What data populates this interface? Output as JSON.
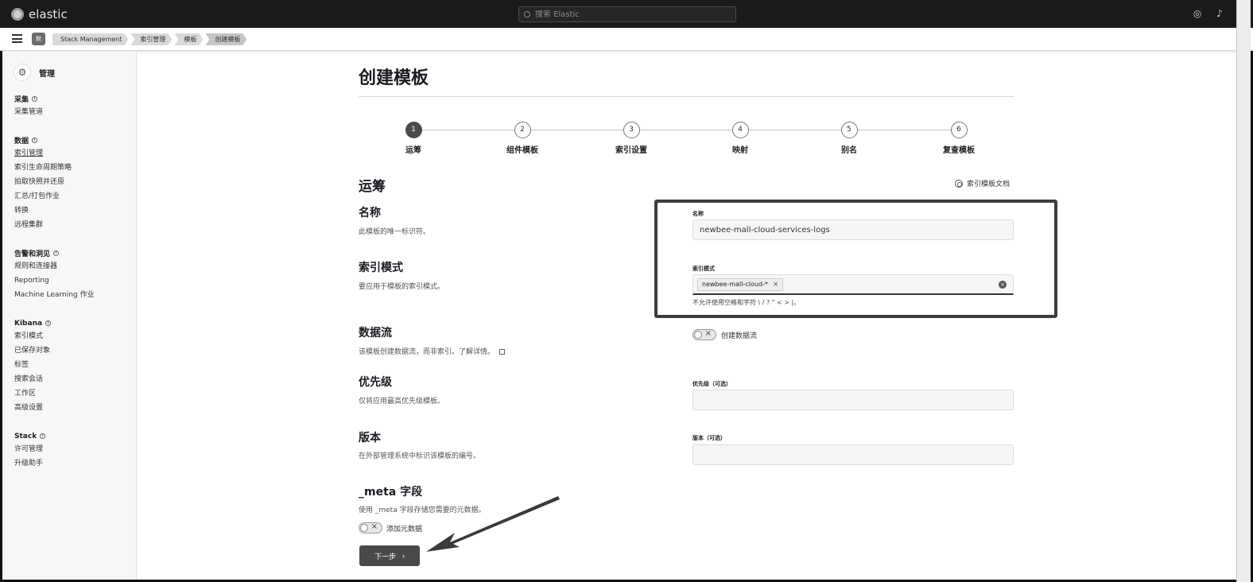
{
  "topbar": {
    "brand": "elastic",
    "search_placeholder": "搜索 Elastic"
  },
  "breadcrumb": {
    "space_initial": "默",
    "items": [
      "Stack Management",
      "索引管理",
      "模板",
      "创建模板"
    ]
  },
  "sidebar": {
    "title": "管理",
    "groups": [
      {
        "title": "采集",
        "items": [
          "采集管道"
        ]
      },
      {
        "title": "数据",
        "items": [
          "索引管理",
          "索引生命周期策略",
          "拍取快照并还原",
          "汇总/打包作业",
          "转换",
          "远程集群"
        ]
      },
      {
        "title": "告警和洞见",
        "items": [
          "规则和连接器",
          "Reporting",
          "Machine Learning 作业"
        ]
      },
      {
        "title": "Kibana",
        "items": [
          "索引模式",
          "已保存对象",
          "标签",
          "搜索会话",
          "工作区",
          "高级设置"
        ]
      },
      {
        "title": "Stack",
        "items": [
          "许可管理",
          "升级助手"
        ]
      }
    ]
  },
  "page": {
    "title": "创建模板",
    "steps": [
      {
        "num": "1",
        "label": "运筹"
      },
      {
        "num": "2",
        "label": "组件模板"
      },
      {
        "num": "3",
        "label": "索引设置"
      },
      {
        "num": "4",
        "label": "映射"
      },
      {
        "num": "5",
        "label": "别名"
      },
      {
        "num": "6",
        "label": "复查模板"
      }
    ],
    "current_step": 1,
    "section_title": "运筹",
    "doc_link": "索引模板文档",
    "fields": {
      "name": {
        "title": "名称",
        "desc": "此模板的唯一标识符。",
        "label": "名称",
        "value": "newbee-mall-cloud-services-logs"
      },
      "index_pattern": {
        "title": "索引模式",
        "desc": "要应用于模板的索引模式。",
        "label": "索引模式",
        "chip": "newbee-mall-cloud-*",
        "helper": "不允许使用空格和字符 \\ / ? \" < > |。"
      },
      "data_stream": {
        "title": "数据流",
        "desc": "该模板创建数据流，而非索引。了解详情。",
        "toggle_label": "创建数据流"
      },
      "priority": {
        "title": "优先级",
        "desc": "仅将应用最高优先级模板。",
        "label": "优先级（可选）",
        "value": ""
      },
      "version": {
        "title": "版本",
        "desc": "在外部管理系统中标识该模板的编号。",
        "label": "版本（可选）",
        "value": ""
      },
      "meta": {
        "title": "_meta 字段",
        "desc": "使用 _meta 字段存储您需要的元数据。",
        "toggle_label": "添加元数据"
      }
    },
    "next_button": "下一步"
  }
}
